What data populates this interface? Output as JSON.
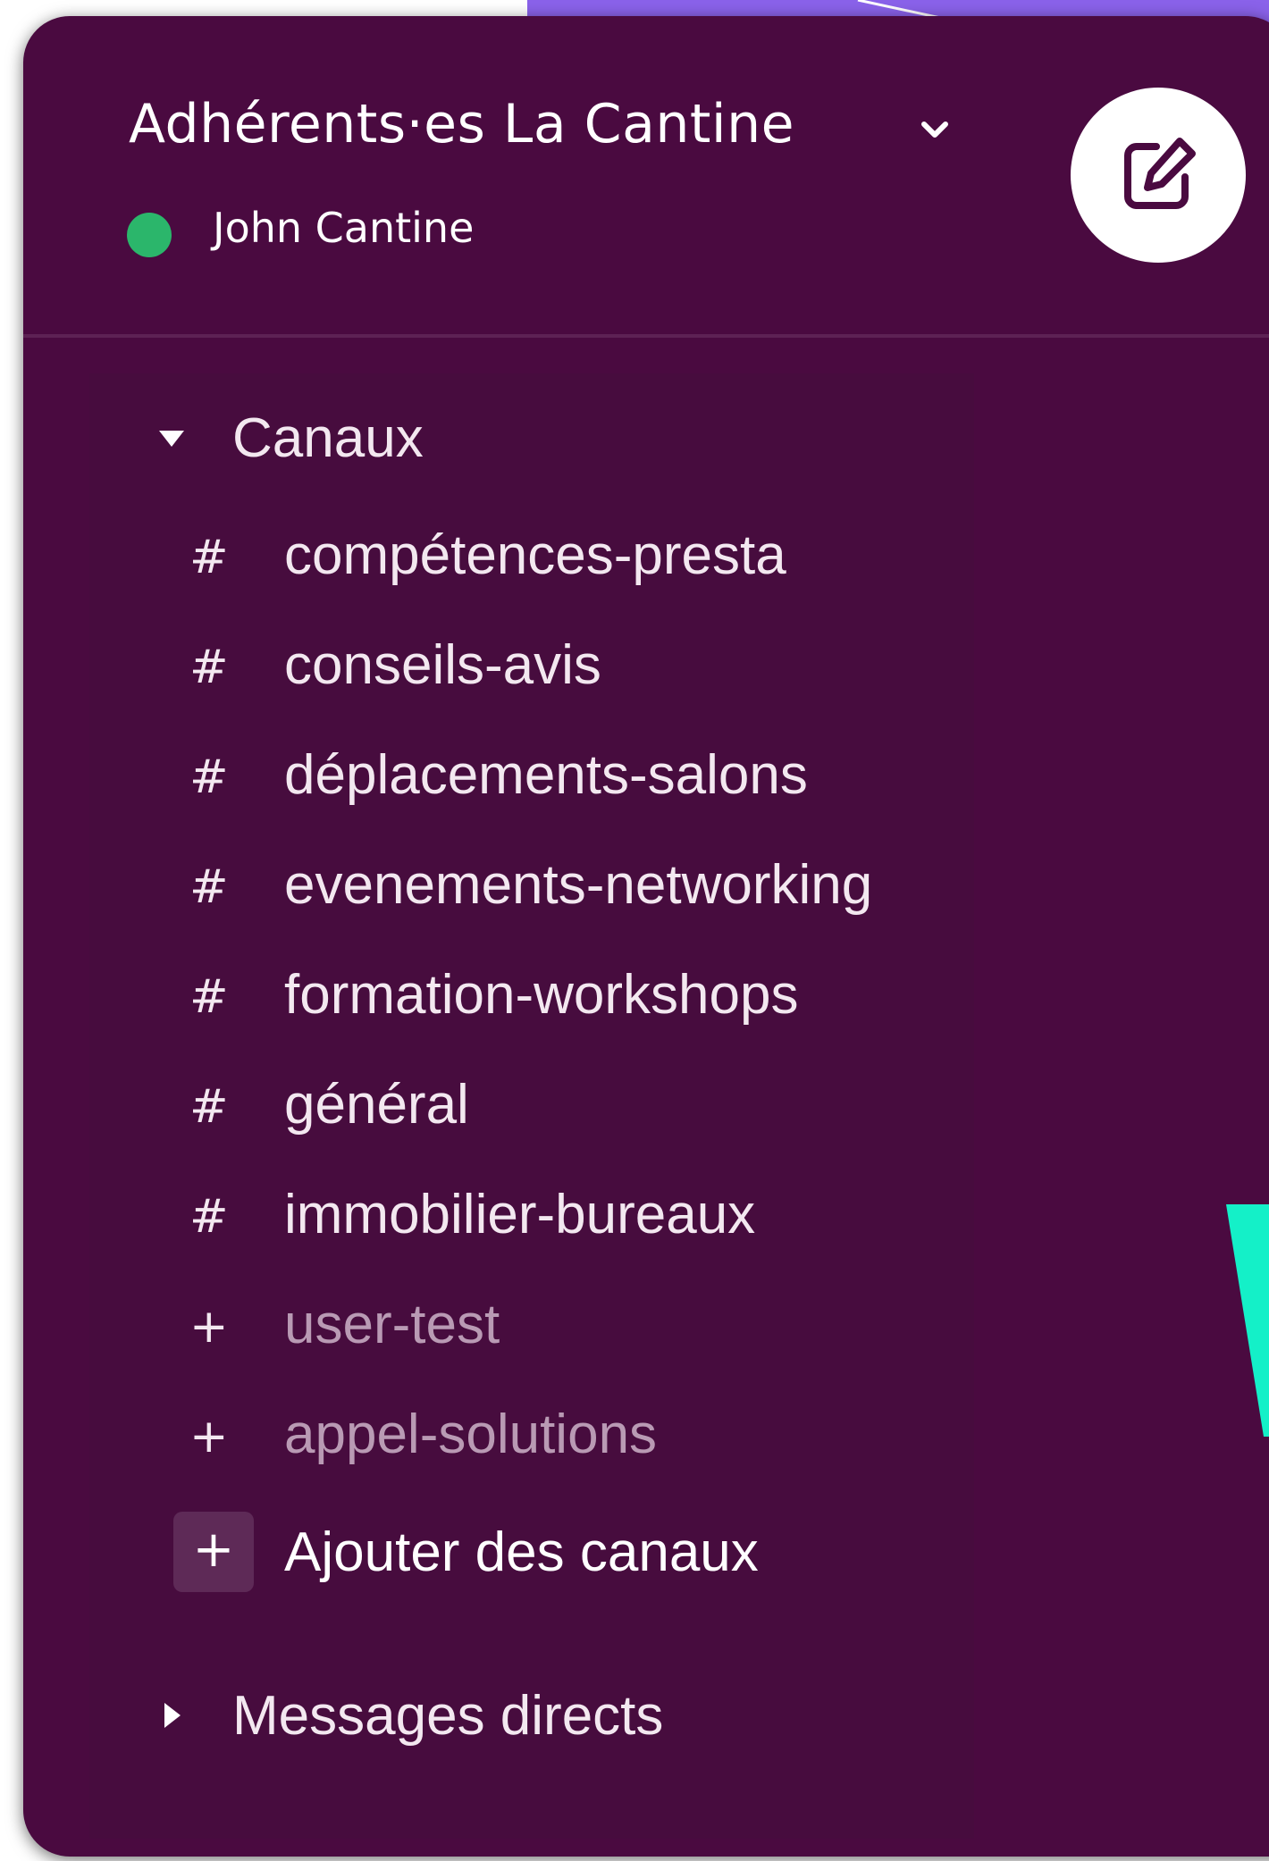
{
  "colors": {
    "sidebar_bg": "#4a0a40",
    "accent_purple": "#8a62ea",
    "presence_green": "#2bb66b",
    "accent_teal": "#14f0c8",
    "muted_text": "#b99ab4"
  },
  "workspace": {
    "name": "Adhérents·es La Cantine",
    "menu_icon": "chevron-down-icon",
    "user": {
      "name": "John Cantine",
      "status": "active",
      "status_icon": "presence-dot-icon"
    },
    "compose_icon": "compose-edit-icon"
  },
  "channels_section": {
    "label": "Canaux",
    "state": "expanded",
    "items": [
      {
        "prefix": "#",
        "name": "compétences-presta",
        "joined": true
      },
      {
        "prefix": "#",
        "name": "conseils-avis",
        "joined": true
      },
      {
        "prefix": "#",
        "name": "déplacements-salons",
        "joined": true
      },
      {
        "prefix": "#",
        "name": "evenements-networking",
        "joined": true
      },
      {
        "prefix": "#",
        "name": "formation-workshops",
        "joined": true
      },
      {
        "prefix": "#",
        "name": "général",
        "joined": true
      },
      {
        "prefix": "#",
        "name": "immobilier-bureaux",
        "joined": true
      },
      {
        "prefix": "+",
        "name": "user-test",
        "joined": false
      },
      {
        "prefix": "+",
        "name": "appel-solutions",
        "joined": false
      }
    ],
    "add": {
      "icon": "+",
      "label": "Ajouter des canaux"
    }
  },
  "dm_section": {
    "label": "Messages directs",
    "state": "collapsed"
  }
}
